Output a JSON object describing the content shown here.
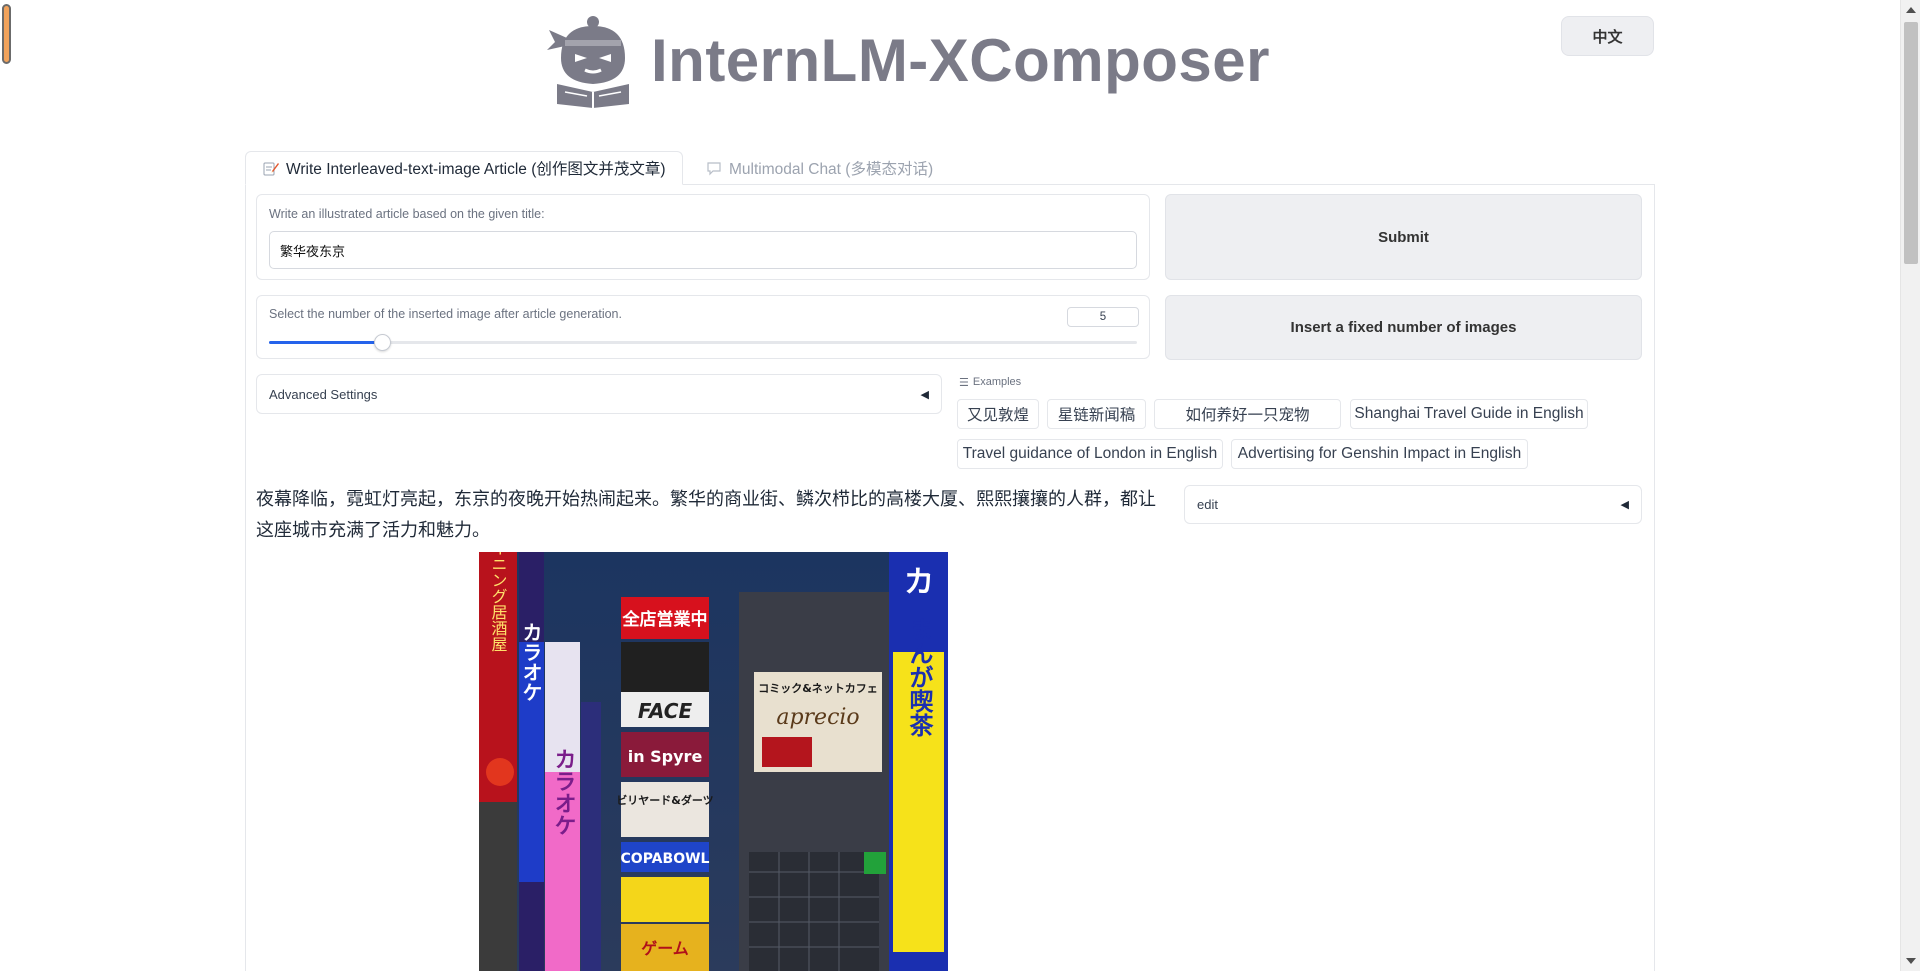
{
  "header": {
    "app_title": "InternLM-XComposer",
    "language_button": "中文"
  },
  "tabs": [
    {
      "label": "Write Interleaved-text-image Article (创作图文并茂文章)",
      "icon": "edit-icon",
      "active": true
    },
    {
      "label": "Multimodal Chat (多模态对话)",
      "icon": "chat-bubble-icon",
      "active": false
    }
  ],
  "article_form": {
    "title_label": "Write an illustrated article based on the given title:",
    "title_value": "繁华夜东京",
    "slider_label": "Select the number of the inserted image after article generation.",
    "slider_value": "5",
    "slider_fraction": 0.13,
    "submit_label": "Submit",
    "insert_label": "Insert a fixed number of images",
    "advanced_settings_label": "Advanced Settings",
    "advanced_arrow": "◀"
  },
  "examples": {
    "header": "Examples",
    "items": [
      "又见敦煌",
      "星链新闻稿",
      "如何养好一只宠物",
      "Shanghai Travel Guide in English",
      "Travel guidance of London in English",
      "Advertising for Genshin Impact in English"
    ]
  },
  "output": {
    "paragraph": "夜幕降临，霓虹灯亮起，东京的夜晚开始热闹起来。繁华的商业街、鳞次栉比的高楼大厦、熙熙攘攘的人群，都让这座城市充满了活力和魅力。",
    "edit_label": "edit",
    "edit_arrow": "◀",
    "image_sign_text": {
      "sign_1": "全店営業中",
      "sign_2": "カラオケ",
      "sign_3": "まんが喫茶",
      "sign_4": "FACE",
      "sign_5": "in Spyre",
      "sign_6": "ビリヤード&ダーツ",
      "sign_7": "COPABOWL",
      "sign_8": "コミック&ネットカフェ",
      "sign_9": "aprecio",
      "sign_10": "ゲーム",
      "sign_11": "個室ダイニング居酒屋"
    }
  },
  "colors": {
    "accent": "#2563eb",
    "logo_gray": "#7b7b88",
    "button_bg": "#eeeff2"
  }
}
